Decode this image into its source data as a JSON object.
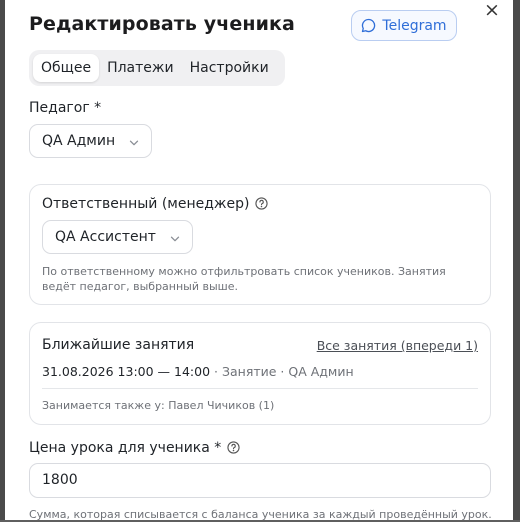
{
  "modal": {
    "title": "Редактировать ученика",
    "telegram_label": "Telegram",
    "close_symbol": "×"
  },
  "tabs": [
    {
      "label": "Общее",
      "active": true
    },
    {
      "label": "Платежи",
      "active": false
    },
    {
      "label": "Настройки",
      "active": false
    }
  ],
  "teacher": {
    "label": "Педагог *",
    "value": "QA Админ"
  },
  "manager": {
    "label": "Ответственный (менеджер)",
    "value": "QA Ассистент",
    "hint_line1": "По ответственному можно отфильтровать список учеников. Занятия",
    "hint_line2": "ведёт педагог, выбранный выше."
  },
  "upcoming": {
    "title": "Ближайшие занятия",
    "all_link": "Все занятия (впереди 1)",
    "lesson_time": "31.08.2026 13:00 — 14:00",
    "lesson_meta": " · Занятие · QA Админ",
    "also_studies": "Занимается также у: Павел Чичиков (1)"
  },
  "price": {
    "label": "Цена урока для ученика *",
    "value": "1800",
    "hint": "Сумма, которая списывается с баланса ученика за каждый проведённый урок."
  },
  "colors": {
    "accent": "#2f6ed8",
    "overlay": "#5f5f5f"
  },
  "icons": [
    "chat-bubble-icon",
    "close-icon",
    "chevron-down-icon",
    "help-circle-icon"
  ]
}
